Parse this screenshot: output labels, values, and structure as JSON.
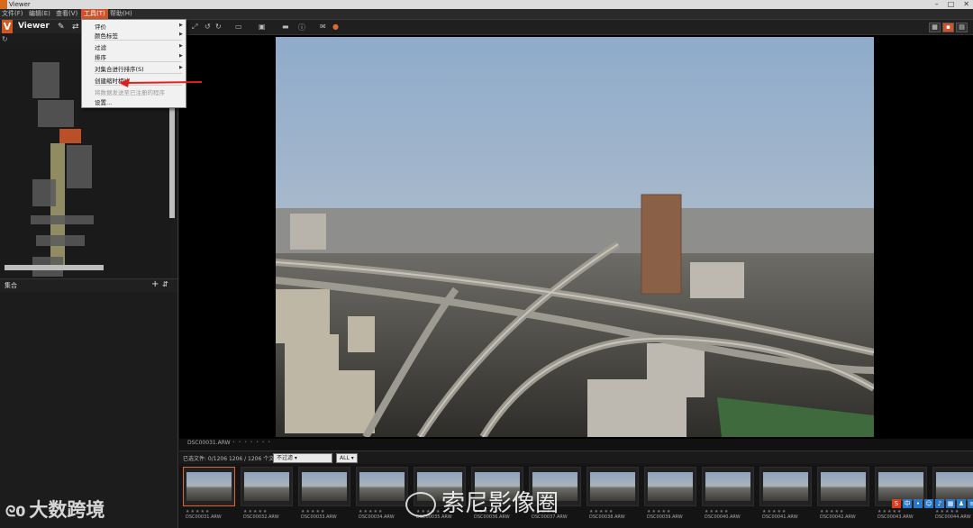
{
  "window": {
    "title": "Viewer"
  },
  "menubar": {
    "items": [
      "文件(F)",
      "编辑(E)",
      "查看(V)",
      "工具(T)",
      "帮助(H)"
    ],
    "active_index": 3
  },
  "left_panel": {
    "app_name": "Viewer",
    "collection_label": "集合"
  },
  "dropdown": {
    "items": [
      {
        "label": "评价",
        "submenu": true,
        "disabled": false
      },
      {
        "label": "颜色标签",
        "submenu": true,
        "disabled": false
      },
      {
        "label": "过滤",
        "submenu": true,
        "disabled": false
      },
      {
        "label": "排序",
        "submenu": true,
        "disabled": false
      },
      {
        "label": "对集合进行排序(S)",
        "submenu": true,
        "disabled": false
      },
      {
        "label": "创建缩时相片",
        "submenu": false,
        "disabled": false,
        "highlighted_by_arrow": true
      },
      {
        "label": "将数据发送至已注册的程序",
        "submenu": false,
        "disabled": true
      },
      {
        "label": "设置...",
        "submenu": false,
        "disabled": false
      }
    ]
  },
  "viewer": {
    "current_file": "DSC00031.ARW",
    "photo": {
      "subject": "city-skyline-with-highway-interchange",
      "sky_color": "#9fb7d2",
      "haze_color": "#b7bcc0"
    }
  },
  "filterbar": {
    "count_text": "已选文件: 0/1206   1206 / 1206 个文件",
    "filter_select": "不过滤",
    "all_select": "ALL"
  },
  "filmstrip": {
    "thumbnails": [
      {
        "name": "DSC00031.ARW",
        "active": true
      },
      {
        "name": "DSC00032.ARW",
        "active": false
      },
      {
        "name": "DSC00033.ARW",
        "active": false
      },
      {
        "name": "DSC00034.ARW",
        "active": false
      },
      {
        "name": "DSC00035.ARW",
        "active": false
      },
      {
        "name": "DSC00036.ARW",
        "active": false
      },
      {
        "name": "DSC00037.ARW",
        "active": false
      },
      {
        "name": "DSC00038.ARW",
        "active": false
      },
      {
        "name": "DSC00039.ARW",
        "active": false
      },
      {
        "name": "DSC00040.ARW",
        "active": false
      },
      {
        "name": "DSC00041.ARW",
        "active": false
      },
      {
        "name": "DSC00042.ARW",
        "active": false
      },
      {
        "name": "DSC00043.ARW",
        "active": false
      },
      {
        "name": "DSC00044.ARW",
        "active": false
      }
    ],
    "stars": "★★★★★"
  },
  "watermarks": {
    "left": "大数跨境",
    "center": "索尼影像圈"
  },
  "colors": {
    "accent": "#d0522a",
    "panel": "#1c1c1c",
    "menu_bg": "#f1f1f1"
  }
}
